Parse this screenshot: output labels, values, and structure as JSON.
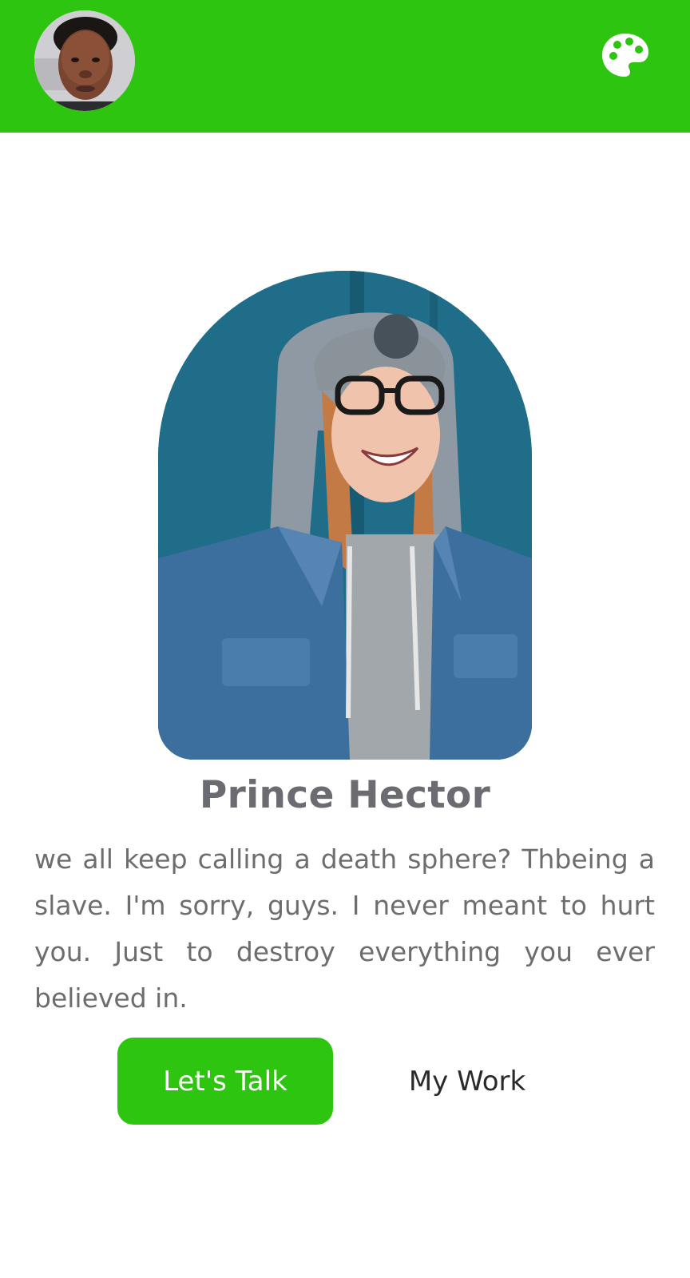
{
  "theme": {
    "accent": "#2dc50f",
    "name_color": "#6b6b72",
    "bio_color": "#6d6d6d"
  },
  "header": {
    "avatar_icon": "user-avatar",
    "theme_icon": "palette-icon"
  },
  "profile": {
    "name": "Prince Hector",
    "bio": "we all keep calling a death sphere? Thbeing a slave. I'm sorry, guys. I never meant to hurt you. Just to destroy everything you ever believed in."
  },
  "actions": {
    "primary_label": "Let's Talk",
    "secondary_label": "My Work"
  }
}
